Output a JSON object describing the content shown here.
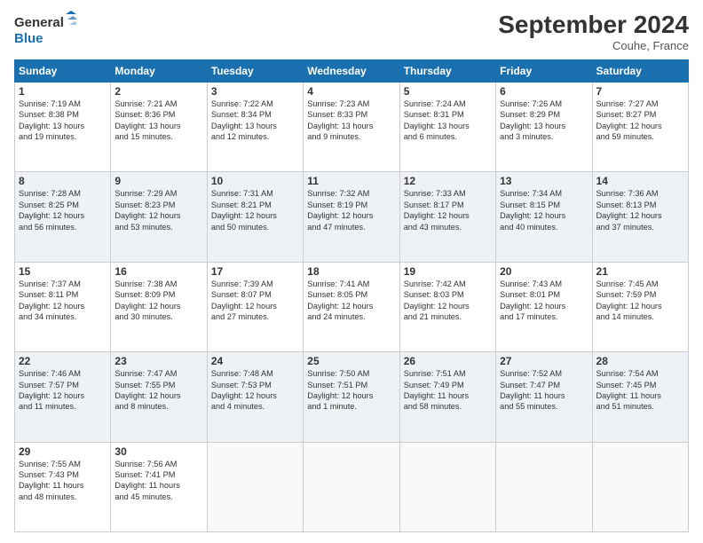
{
  "logo": {
    "line1": "General",
    "line2": "Blue"
  },
  "title": "September 2024",
  "location": "Couhe, France",
  "days_of_week": [
    "Sunday",
    "Monday",
    "Tuesday",
    "Wednesday",
    "Thursday",
    "Friday",
    "Saturday"
  ],
  "weeks": [
    [
      {
        "num": "1",
        "lines": [
          "Sunrise: 7:19 AM",
          "Sunset: 8:38 PM",
          "Daylight: 13 hours",
          "and 19 minutes."
        ]
      },
      {
        "num": "2",
        "lines": [
          "Sunrise: 7:21 AM",
          "Sunset: 8:36 PM",
          "Daylight: 13 hours",
          "and 15 minutes."
        ]
      },
      {
        "num": "3",
        "lines": [
          "Sunrise: 7:22 AM",
          "Sunset: 8:34 PM",
          "Daylight: 13 hours",
          "and 12 minutes."
        ]
      },
      {
        "num": "4",
        "lines": [
          "Sunrise: 7:23 AM",
          "Sunset: 8:33 PM",
          "Daylight: 13 hours",
          "and 9 minutes."
        ]
      },
      {
        "num": "5",
        "lines": [
          "Sunrise: 7:24 AM",
          "Sunset: 8:31 PM",
          "Daylight: 13 hours",
          "and 6 minutes."
        ]
      },
      {
        "num": "6",
        "lines": [
          "Sunrise: 7:26 AM",
          "Sunset: 8:29 PM",
          "Daylight: 13 hours",
          "and 3 minutes."
        ]
      },
      {
        "num": "7",
        "lines": [
          "Sunrise: 7:27 AM",
          "Sunset: 8:27 PM",
          "Daylight: 12 hours",
          "and 59 minutes."
        ]
      }
    ],
    [
      {
        "num": "8",
        "lines": [
          "Sunrise: 7:28 AM",
          "Sunset: 8:25 PM",
          "Daylight: 12 hours",
          "and 56 minutes."
        ]
      },
      {
        "num": "9",
        "lines": [
          "Sunrise: 7:29 AM",
          "Sunset: 8:23 PM",
          "Daylight: 12 hours",
          "and 53 minutes."
        ]
      },
      {
        "num": "10",
        "lines": [
          "Sunrise: 7:31 AM",
          "Sunset: 8:21 PM",
          "Daylight: 12 hours",
          "and 50 minutes."
        ]
      },
      {
        "num": "11",
        "lines": [
          "Sunrise: 7:32 AM",
          "Sunset: 8:19 PM",
          "Daylight: 12 hours",
          "and 47 minutes."
        ]
      },
      {
        "num": "12",
        "lines": [
          "Sunrise: 7:33 AM",
          "Sunset: 8:17 PM",
          "Daylight: 12 hours",
          "and 43 minutes."
        ]
      },
      {
        "num": "13",
        "lines": [
          "Sunrise: 7:34 AM",
          "Sunset: 8:15 PM",
          "Daylight: 12 hours",
          "and 40 minutes."
        ]
      },
      {
        "num": "14",
        "lines": [
          "Sunrise: 7:36 AM",
          "Sunset: 8:13 PM",
          "Daylight: 12 hours",
          "and 37 minutes."
        ]
      }
    ],
    [
      {
        "num": "15",
        "lines": [
          "Sunrise: 7:37 AM",
          "Sunset: 8:11 PM",
          "Daylight: 12 hours",
          "and 34 minutes."
        ]
      },
      {
        "num": "16",
        "lines": [
          "Sunrise: 7:38 AM",
          "Sunset: 8:09 PM",
          "Daylight: 12 hours",
          "and 30 minutes."
        ]
      },
      {
        "num": "17",
        "lines": [
          "Sunrise: 7:39 AM",
          "Sunset: 8:07 PM",
          "Daylight: 12 hours",
          "and 27 minutes."
        ]
      },
      {
        "num": "18",
        "lines": [
          "Sunrise: 7:41 AM",
          "Sunset: 8:05 PM",
          "Daylight: 12 hours",
          "and 24 minutes."
        ]
      },
      {
        "num": "19",
        "lines": [
          "Sunrise: 7:42 AM",
          "Sunset: 8:03 PM",
          "Daylight: 12 hours",
          "and 21 minutes."
        ]
      },
      {
        "num": "20",
        "lines": [
          "Sunrise: 7:43 AM",
          "Sunset: 8:01 PM",
          "Daylight: 12 hours",
          "and 17 minutes."
        ]
      },
      {
        "num": "21",
        "lines": [
          "Sunrise: 7:45 AM",
          "Sunset: 7:59 PM",
          "Daylight: 12 hours",
          "and 14 minutes."
        ]
      }
    ],
    [
      {
        "num": "22",
        "lines": [
          "Sunrise: 7:46 AM",
          "Sunset: 7:57 PM",
          "Daylight: 12 hours",
          "and 11 minutes."
        ]
      },
      {
        "num": "23",
        "lines": [
          "Sunrise: 7:47 AM",
          "Sunset: 7:55 PM",
          "Daylight: 12 hours",
          "and 8 minutes."
        ]
      },
      {
        "num": "24",
        "lines": [
          "Sunrise: 7:48 AM",
          "Sunset: 7:53 PM",
          "Daylight: 12 hours",
          "and 4 minutes."
        ]
      },
      {
        "num": "25",
        "lines": [
          "Sunrise: 7:50 AM",
          "Sunset: 7:51 PM",
          "Daylight: 12 hours",
          "and 1 minute."
        ]
      },
      {
        "num": "26",
        "lines": [
          "Sunrise: 7:51 AM",
          "Sunset: 7:49 PM",
          "Daylight: 11 hours",
          "and 58 minutes."
        ]
      },
      {
        "num": "27",
        "lines": [
          "Sunrise: 7:52 AM",
          "Sunset: 7:47 PM",
          "Daylight: 11 hours",
          "and 55 minutes."
        ]
      },
      {
        "num": "28",
        "lines": [
          "Sunrise: 7:54 AM",
          "Sunset: 7:45 PM",
          "Daylight: 11 hours",
          "and 51 minutes."
        ]
      }
    ],
    [
      {
        "num": "29",
        "lines": [
          "Sunrise: 7:55 AM",
          "Sunset: 7:43 PM",
          "Daylight: 11 hours",
          "and 48 minutes."
        ]
      },
      {
        "num": "30",
        "lines": [
          "Sunrise: 7:56 AM",
          "Sunset: 7:41 PM",
          "Daylight: 11 hours",
          "and 45 minutes."
        ]
      },
      null,
      null,
      null,
      null,
      null
    ]
  ]
}
